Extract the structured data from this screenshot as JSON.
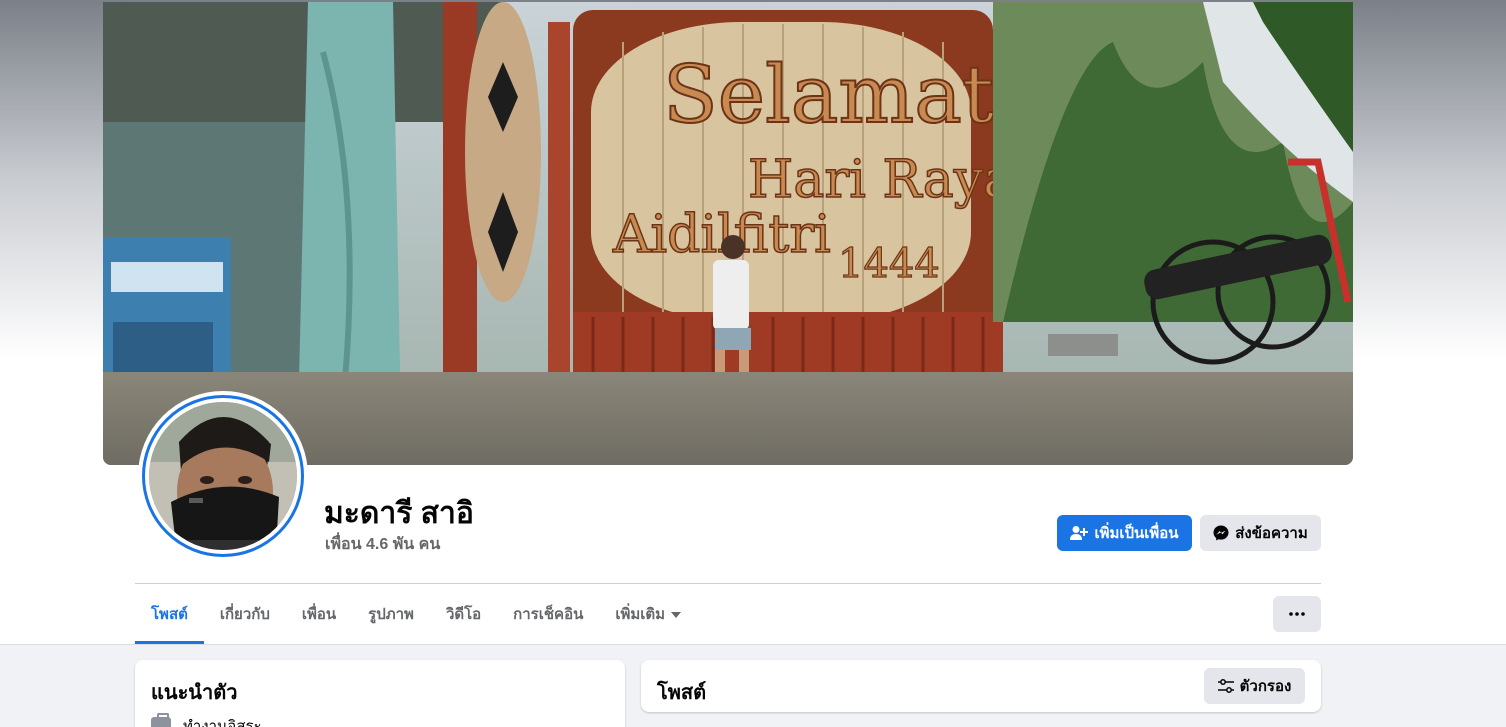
{
  "profile": {
    "name": "มะดารี สาอิ",
    "friends": "เพื่อน 4.6 พัน คน"
  },
  "actions": {
    "add_friend": "เพิ่มเป็นเพื่อน",
    "message": "ส่งข้อความ",
    "more": "more-options"
  },
  "cover": {
    "sign_line1": "Selamat",
    "sign_line2": "Hari Raya",
    "sign_line3": "Aidilfitri",
    "sign_year": "1444"
  },
  "tabs": [
    {
      "label": "โพสต์",
      "active": true
    },
    {
      "label": "เกี่ยวกับ",
      "active": false
    },
    {
      "label": "เพื่อน",
      "active": false
    },
    {
      "label": "รูปภาพ",
      "active": false
    },
    {
      "label": "วิดีโอ",
      "active": false
    },
    {
      "label": "การเช็คอิน",
      "active": false
    },
    {
      "label": "เพิ่มเติม",
      "active": false
    }
  ],
  "intro": {
    "title": "แนะนำตัว",
    "work": "ทำงานอิสระ"
  },
  "posts": {
    "title": "โพสต์",
    "filter": "ตัวกรอง"
  },
  "colors": {
    "accent": "#1b74e4",
    "secondary_button": "#e4e6eb",
    "muted_text": "#65676b",
    "page_bg": "#f0f2f5"
  }
}
